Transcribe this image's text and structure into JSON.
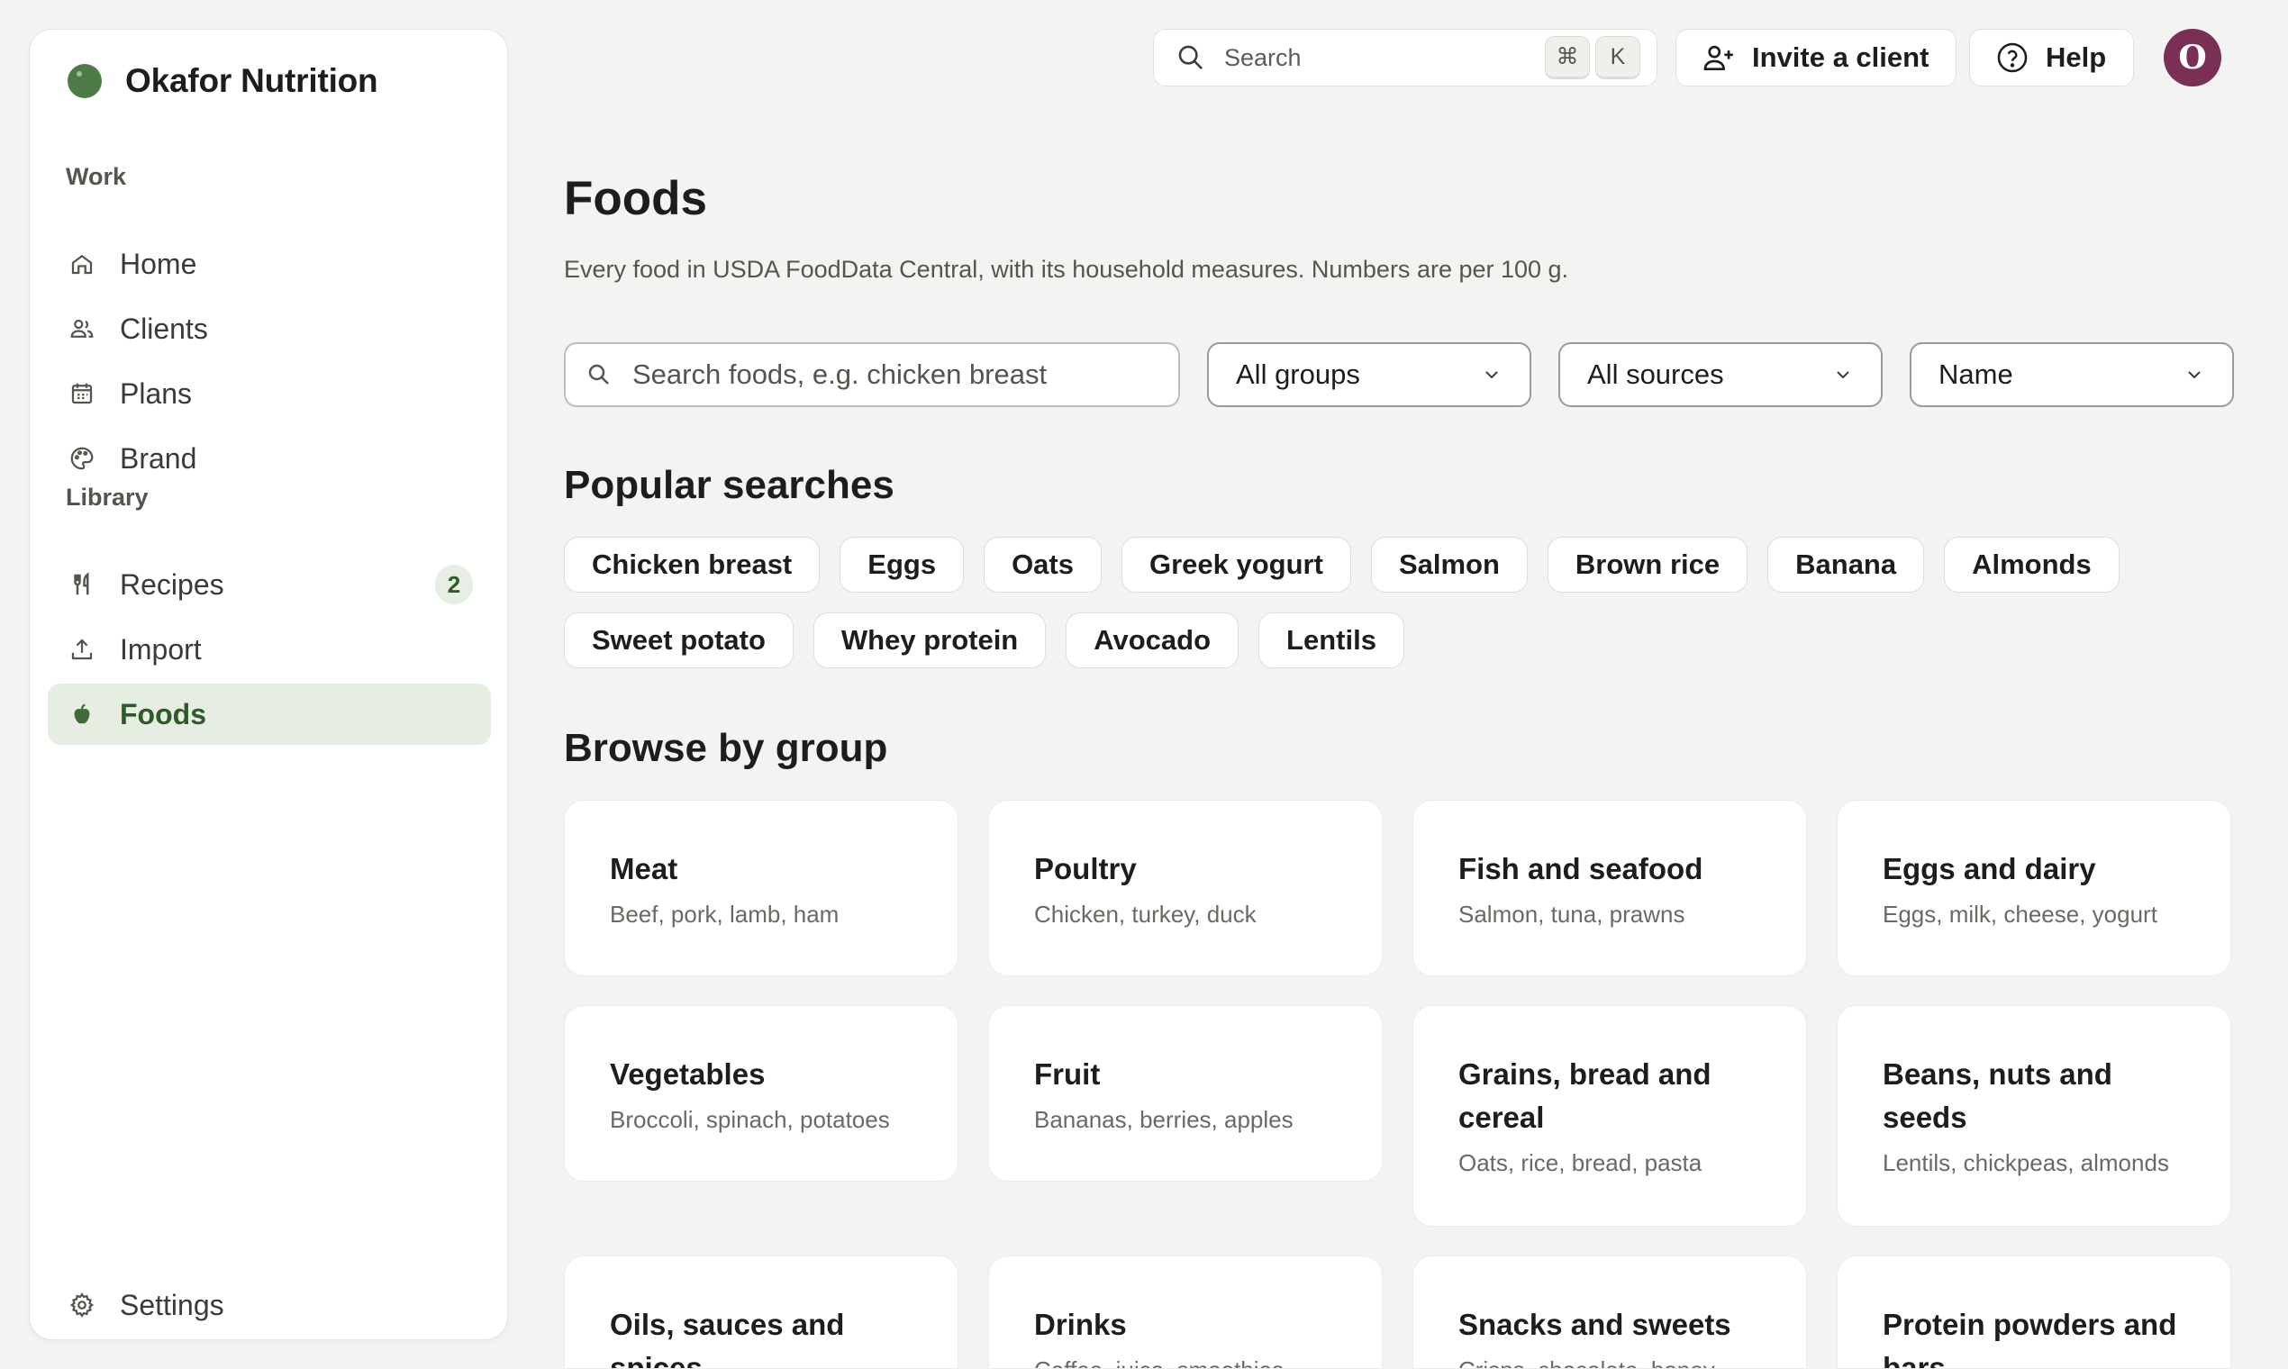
{
  "sidebar": {
    "brand_name": "Okafor Nutrition",
    "sections": {
      "work": "Work",
      "library": "Library"
    },
    "items": {
      "home": "Home",
      "clients": "Clients",
      "plans": "Plans",
      "brand": "Brand",
      "recipes": "Recipes",
      "recipes_badge": "2",
      "import": "Import",
      "foods": "Foods",
      "settings": "Settings"
    }
  },
  "topbar": {
    "search_placeholder": "Search",
    "shortcut_cmd": "⌘",
    "shortcut_key": "K",
    "invite_label": "Invite a client",
    "help_label": "Help",
    "avatar_initial": "O",
    "avatar_color": "#7a2f55"
  },
  "main": {
    "title": "Foods",
    "subtitle": "Every food in USDA FoodData Central, with its household measures. Numbers are per 100 g.",
    "search_placeholder": "Search foods, e.g. chicken breast",
    "filters": {
      "group": "All groups",
      "source": "All sources",
      "sort": "Name"
    },
    "popular_title": "Popular searches",
    "popular": [
      "Chicken breast",
      "Eggs",
      "Oats",
      "Greek yogurt",
      "Salmon",
      "Brown rice",
      "Banana",
      "Almonds",
      "Sweet potato",
      "Whey protein",
      "Avocado",
      "Lentils"
    ],
    "browse_title": "Browse by group",
    "groups": [
      {
        "name": "Meat",
        "desc": "Beef, pork, lamb, ham"
      },
      {
        "name": "Poultry",
        "desc": "Chicken, turkey, duck"
      },
      {
        "name": "Fish and seafood",
        "desc": "Salmon, tuna, prawns"
      },
      {
        "name": "Eggs and dairy",
        "desc": "Eggs, milk, cheese, yogurt"
      },
      {
        "name": "Vegetables",
        "desc": "Broccoli, spinach, potatoes"
      },
      {
        "name": "Fruit",
        "desc": "Bananas, berries, apples"
      },
      {
        "name": "Grains, bread and cereal",
        "desc": "Oats, rice, bread, pasta"
      },
      {
        "name": "Beans, nuts and seeds",
        "desc": "Lentils, chickpeas, almonds"
      },
      {
        "name": "Oils, sauces and spices",
        "desc": ""
      },
      {
        "name": "Drinks",
        "desc": "Coffee, juice, smoothies"
      },
      {
        "name": "Snacks and sweets",
        "desc": "Crisps, chocolate, honey"
      },
      {
        "name": "Protein powders and bars",
        "desc": ""
      }
    ]
  },
  "colors": {
    "accent_green": "#4d7a47",
    "active_bg": "#e6ede3",
    "page_bg": "#f3f3f1"
  }
}
